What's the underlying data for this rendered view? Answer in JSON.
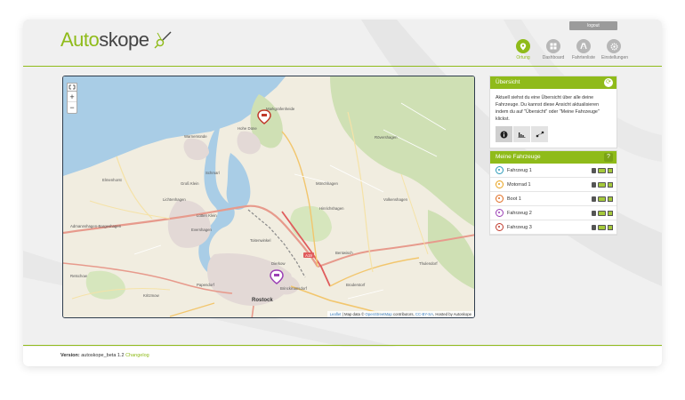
{
  "app": {
    "logo_part1": "Auto",
    "logo_part2": "skope"
  },
  "header": {
    "logout_label": "logout",
    "nav": [
      {
        "label": "Ortung",
        "icon": "location-pin-icon",
        "active": true
      },
      {
        "label": "Dashboard",
        "icon": "dashboard-grid-icon",
        "active": false
      },
      {
        "label": "Fahrtenliste",
        "icon": "routes-icon",
        "active": false
      },
      {
        "label": "Einstellungen",
        "icon": "gear-icon",
        "active": false
      }
    ]
  },
  "map": {
    "zoom_in": "+",
    "zoom_out": "−",
    "attribution_leaflet": "Leaflet",
    "attribution_sep1": " | Map data © ",
    "attribution_osm": "OpenStreetMap",
    "attribution_mid": " contributors, ",
    "attribution_cc": "CC-BY-SA",
    "attribution_end": ", Hosted by Autoskope",
    "labels": {
      "rostock": "Rostock",
      "warnemuende": "Warnemünde",
      "hohe_duene": "Hohe Düne",
      "markgrafenheide": "Markgrafenheide",
      "lichtenhagen": "Lichtenhagen",
      "gross_klein": "Groß Klein",
      "luetten_klein": "Lütten Klein",
      "evershagen": "Evershagen",
      "schmarl": "Schmarl",
      "toitenwinkel": "Toitenwinkel",
      "dierkow": "Dierkow",
      "brinckmansdorf": "Brinckmansdorf",
      "bentwisch": "Bentwisch",
      "roevershagen": "Rövershagen",
      "mönchhagen": "Mönchhagen",
      "kritzmow": "Kritzmow",
      "papendorf": "Papendorf",
      "broderstorf": "Broderstorf",
      "elmenhorst": "Elmenhorst",
      "admannshagen": "Admannshagen-Bargeshagen",
      "retschow": "Retschow",
      "hinrichshagen": "Hinrichshagen",
      "volkenshagen": "Volkenshagen",
      "thulendorf": "Thulendorf",
      "a19": "A19"
    }
  },
  "overview": {
    "title": "Übersicht",
    "text": "Aktuell siehst du eine Übersicht über alle deine Fahrzeuge. Du kannst diese Ansicht aktualisieren indem du auf \"Übersicht\" oder \"Meine Fahrzeuge\" klickst.",
    "tabs": [
      {
        "icon": "info-icon"
      },
      {
        "icon": "bar-chart-icon"
      },
      {
        "icon": "route-dots-icon"
      }
    ]
  },
  "vehicles": {
    "title": "Meine Fahrzeuge",
    "help": "?",
    "items": [
      {
        "name": "Fahrzeug 1",
        "color": "#2a9ab8"
      },
      {
        "name": "Motorrad 1",
        "color": "#e8a21c"
      },
      {
        "name": "Boot 1",
        "color": "#e06b1f"
      },
      {
        "name": "Fahrzeug 2",
        "color": "#9b3fb5"
      },
      {
        "name": "Fahrzeug 3",
        "color": "#c0392b"
      }
    ]
  },
  "footer": {
    "version_label": "Version:",
    "version_value": " autoskope_beta 1.2 ",
    "changelog": "Changelog"
  },
  "colors": {
    "accent": "#8fbb1a",
    "map_water": "#a9cde6",
    "map_land": "#f1ede0",
    "map_forest": "#cfe0b4",
    "map_city": "#e3d9d6"
  }
}
